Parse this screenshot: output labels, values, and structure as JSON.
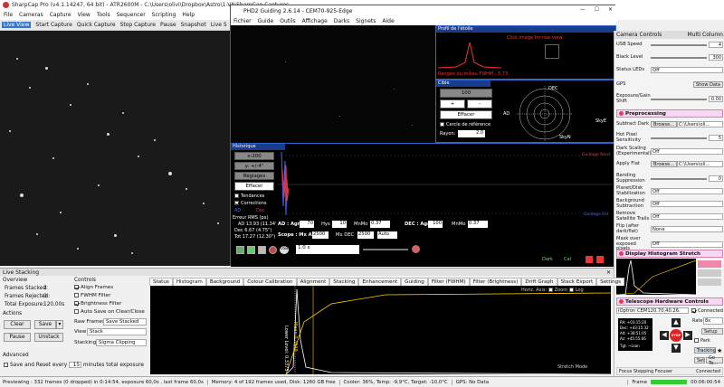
{
  "sharpcap": {
    "title": "SharpCap Pro (v4.1.14247, 64 bit) - ATR2600M - C:\\Users\\olivi\\Dropbox\\Astro\\1-VA\\SharpCap Captures",
    "menu": [
      "File",
      "Cameras",
      "Capture",
      "View",
      "Tools",
      "Sequencer",
      "Scripting",
      "Help"
    ],
    "toolbar": [
      "Live View",
      "Start Capture",
      "Quick Capture",
      "Stop Capture",
      "Pause",
      "Snapshot",
      "Live S"
    ]
  },
  "phd2": {
    "title": "PHD2 Guiding 2.6.14 - CEM70-925-Edge",
    "menu": [
      "Fichier",
      "Guide",
      "Outils",
      "Affichage",
      "Darks",
      "Signets",
      "Aide"
    ],
    "profile": {
      "title": "Profil de l'étoile",
      "hint": "Click image for raw view",
      "footer": "Rangée du milieu FWHM : 5.73"
    },
    "target": {
      "scale_value": "100",
      "btn_plus": "+",
      "btn_minus": "-",
      "btn_clear": "Effacer",
      "ref_circle": "Cercle de référence",
      "radius_label": "Rayon:",
      "radius_value": "2.0",
      "label_dec": "DEC",
      "label_ad": "AD",
      "label_skyw": "SkyE",
      "label_skyn": "SkyN"
    },
    "history": {
      "title": "Historique",
      "scale": "x:200",
      "y_scale": "y: +/-4\"",
      "settings": "Réglages",
      "clear": "Effacer",
      "trends": "Tendances",
      "corrections": "Corrections",
      "ad": "AD",
      "dec": "Dec",
      "rms_title": "Erreur RMS (px)",
      "rms_ad": "AD 13.93 (11.34\")",
      "rms_dec": "Dec 6.67 (4.75\")",
      "rms_tot": "Tot 17.27 (12.30\")",
      "ax_y": [
        "4\"",
        "3\"",
        "2\"",
        "1\"",
        "0",
        "-1\"",
        "-2\"",
        "-3\"",
        "-4\""
      ],
      "lbl_top": "Guidage Nord",
      "lbl_bot": "Guidage Est",
      "ad_agr_label": "AD : Agr",
      "ad_agr": "70",
      "hys_label": "Hys",
      "hys": "10",
      "mnmo_label": "MnMo",
      "mnmo": "0.37",
      "dec_agr_label": "DEC : Agr",
      "dec_agr": "100",
      "dec_mnmo_label": "MnMo",
      "dec_mnmo": "0.37",
      "scope_label": "Scope : Mx AD",
      "scope_ad": "2500",
      "mx_dec_label": "Mx DEC",
      "mx_dec": "2500",
      "auto": "Auto"
    },
    "bottom": {
      "exposure": "1.0 s",
      "dark": "Dark",
      "cal": "Cal"
    }
  },
  "right_panel": {
    "header_left": "Camera Controls",
    "header_right": "Multi Column",
    "usb_label": "USB Speed",
    "usb_value": "4",
    "black_label": "Black Level",
    "black_value": "300",
    "leds_label": "Status LEDs",
    "leds_value": "Off",
    "gps_label": "GPS",
    "gps_btn": "Show Data",
    "expo_label": "Exposure/Gain Shift",
    "expo_value": "0.00",
    "prep_title": "Preprocessing",
    "sub_dark_label": "Subtract Dark",
    "sub_dark_btn": "Browse...",
    "sub_dark_path": "C:\\Users\\oli...",
    "hot_label": "Hot Pixel Sensitivity",
    "hot_value": "5",
    "dark_scale_label": "Dark Scaling (Experimental)",
    "dark_scale_value": "Off",
    "flat_label": "Apply Flat",
    "flat_btn": "Browse...",
    "flat_path": "C:\\Users\\oli...",
    "band_label": "Banding Suppression",
    "band_value": "0",
    "pixel_label": "Planet/Disk Stabilization",
    "pixel_value": "Off",
    "bg_label": "Background Subtraction",
    "bg_value": "Off",
    "sat_label": "Remove Satellite Trails",
    "sat_value": "Off",
    "flip_label": "Flip (after dark/flat)",
    "flip_value": "None",
    "mask_label": "Mask over exposed pixels",
    "mask_value": "Off",
    "hist_title": "Display Histogram Stretch",
    "tel_title": "Telescope Hardware Controls",
    "tel_name": "iOptron CEM120.70.40.26.",
    "tel_connected": "Connected",
    "rate_label": "Rate",
    "rate_value": "8x",
    "setup": "Setup",
    "park": "Park",
    "tracking": "Tracking",
    "stop": "STOP",
    "goto": "Go To...",
    "set": "Set",
    "coords": [
      "RA:",
      "Dec:",
      "Alt:",
      "Az:"
    ],
    "coords_vals": [
      "+03:15:20",
      "+43:15:32",
      "+38:51:05",
      "+45:55:06"
    ],
    "target_label": "Tgt. ~Lsan",
    "bottom_label": "Focus Stepping Focuser",
    "bottom_value": "Connected"
  },
  "live_stacking": {
    "title": "Live Stacking",
    "overview": "Overview",
    "frames_stacked_label": "Frames Stacked:",
    "frames_stacked": "2",
    "frames_rejected_label": "Frames Rejected:",
    "frames_rejected": "0",
    "total_exposure_label": "Total Exposure:",
    "total_exposure": "120,00s",
    "actions": "Actions",
    "clear": "Clear",
    "save": "Save",
    "pause": "Pause",
    "unstack": "Unstack",
    "advanced": "Advanced",
    "save_reset": "Save and Reset every",
    "save_reset_value": "15",
    "save_reset_unit": "minutes total exposure",
    "controls": "Controls",
    "align": "Align Frames",
    "fwhm": "FWHM Filter",
    "brightness": "Brightness Filter",
    "autosave": "Auto Save on Clear/Close",
    "raw_frames_label": "Raw Frames",
    "raw_frames": "Save Stacked",
    "view_label": "View",
    "view": "Stack",
    "stacking_label": "Stacking",
    "stacking": "Sigma Clipping",
    "tabs": [
      "Status",
      "Histogram",
      "Background",
      "Colour Calibration",
      "Alignment",
      "Stacking",
      "Enhancement",
      "Guiding",
      "Filter (FWHM)",
      "Filter (Brightness)",
      "Drift Graph",
      "Stack Export",
      "Settings"
    ],
    "hist_horiz": "Horiz. Axis:",
    "hist_zoom": "Zoom",
    "hist_log": "Log",
    "hist_mean": "Mean 0.3939",
    "hist_lower": "Lower Level: 0.3375",
    "stretch": "Stretch Mode"
  },
  "status": {
    "previewing": "Previewing : 332 frames (0 dropped) in 0:14:54, exposure 60,0s , last frame 60,0s",
    "memory": "Memory: 4 of 192 frames used, Disk: 1260 GB free",
    "cooler": "Cooler: 36%, Temp: -9,9°C, Target: -10,0°C",
    "gps": "GPS: No Data",
    "frame": "Frame",
    "time": "00:06:00:54"
  },
  "colors": {
    "accent_blue": "#3366cc",
    "stop_red": "#d22",
    "pink_section": "#f7d7f3",
    "guide_red": "#e33",
    "guide_blue": "#4466ff"
  }
}
